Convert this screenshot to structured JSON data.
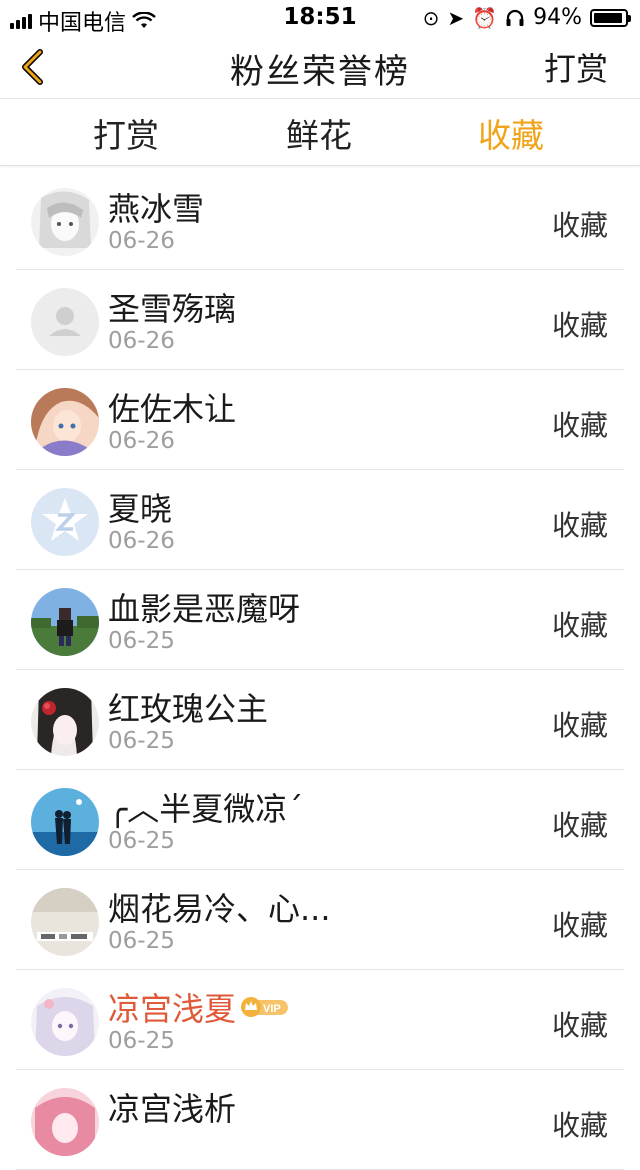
{
  "status_bar": {
    "carrier": "中国电信",
    "time": "18:51",
    "battery": "94%",
    "battery_level": 0.94
  },
  "nav": {
    "title": "粉丝荣誉榜",
    "action": "打赏"
  },
  "tabs": [
    {
      "label": "打赏",
      "active": false
    },
    {
      "label": "鲜花",
      "active": false
    },
    {
      "label": "收藏",
      "active": true
    }
  ],
  "colors": {
    "accent": "#f0a41a",
    "back_arrow": "#f0a41a",
    "vip_name": "#e05a3a",
    "vip_badge": "#f3b23c"
  },
  "rows": [
    {
      "name": "燕冰雪",
      "date": "06-26",
      "label": "收藏",
      "avatar": "anime-girl-sketch-avatar"
    },
    {
      "name": "圣雪殇璃",
      "date": "06-26",
      "label": "收藏",
      "avatar": "default-user-avatar"
    },
    {
      "name": "佐佐木让",
      "date": "06-26",
      "label": "收藏",
      "avatar": "anime-girl-colorful-avatar"
    },
    {
      "name": "夏晓",
      "date": "06-26",
      "label": "收藏",
      "avatar": "qzone-logo-avatar"
    },
    {
      "name": "血影是恶魔呀",
      "date": "06-25",
      "label": "收藏",
      "avatar": "pixel-character-avatar"
    },
    {
      "name": "红玫瑰公主",
      "date": "06-25",
      "label": "收藏",
      "avatar": "anime-girl-red-rose-avatar"
    },
    {
      "name": "╭︿半夏微凉ˊ",
      "date": "06-25",
      "label": "收藏",
      "avatar": "couple-silhouette-avatar"
    },
    {
      "name": "烟花易冷、心...",
      "date": "06-25",
      "label": "收藏",
      "avatar": "text-photo-avatar"
    },
    {
      "name": "凉宫浅夏",
      "date": "06-25",
      "label": "收藏",
      "avatar": "anime-girl-white-avatar",
      "vip": true,
      "vip_text": "VIP"
    },
    {
      "name": "凉宫浅析",
      "date": "",
      "label": "收藏",
      "avatar": "anime-girl-pink-avatar"
    }
  ]
}
